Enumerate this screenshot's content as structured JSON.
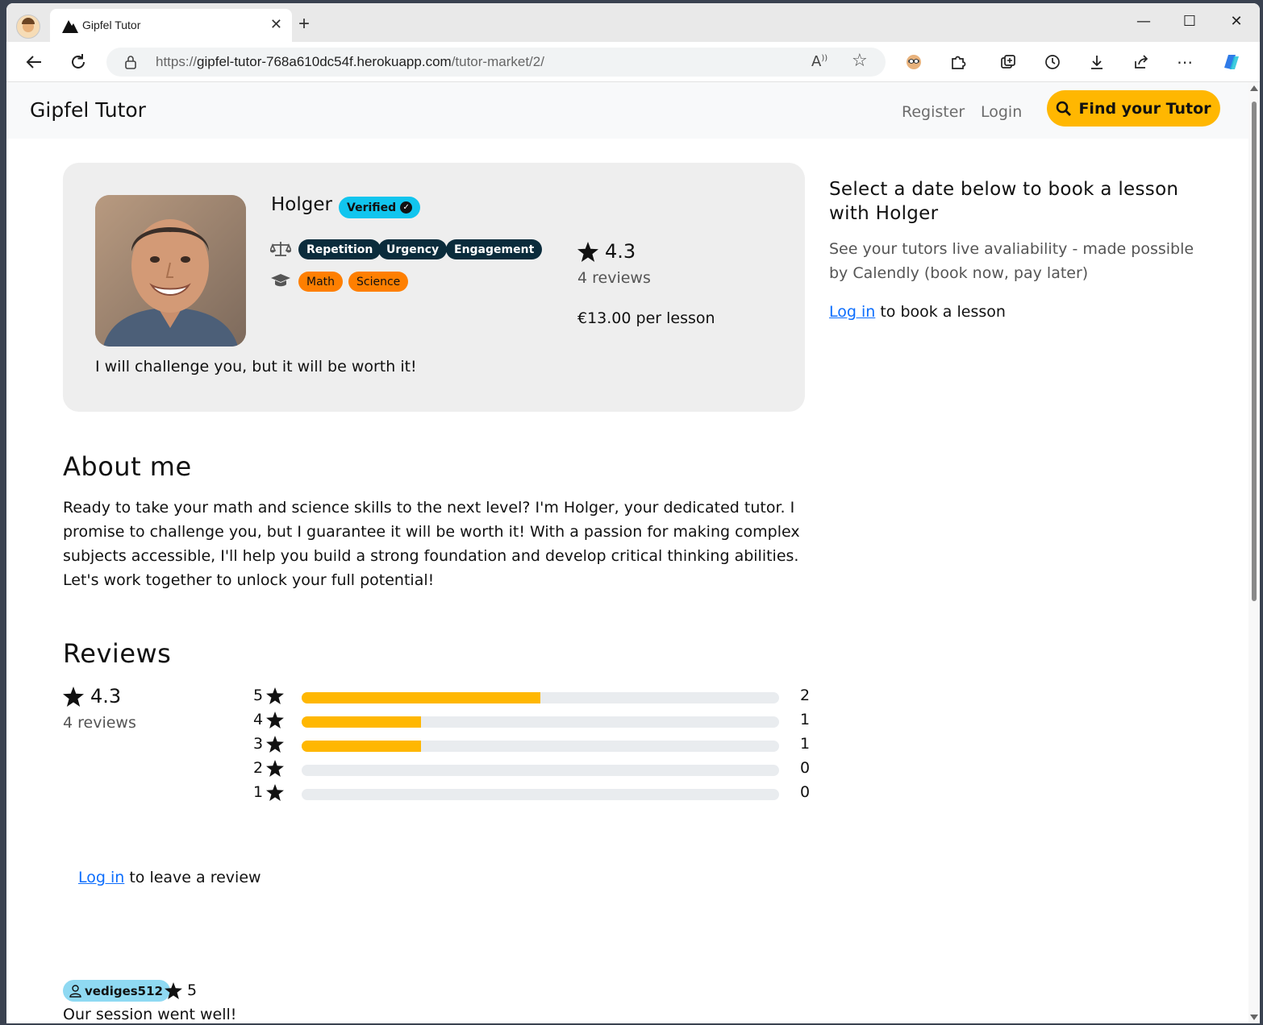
{
  "browser": {
    "tab_title": "Gipfel Tutor",
    "url_prefix": "https://",
    "url_host": "gipfel-tutor-768a610dc54f.herokuapp.com",
    "url_path": "/tutor-market/2/"
  },
  "nav": {
    "brand": "Gipfel Tutor",
    "register": "Register",
    "login": "Login",
    "find_button": "Find your Tutor"
  },
  "tutor": {
    "name": "Holger",
    "verified_label": "Verified",
    "teaching_styles": [
      "Repetition",
      "Urgency",
      "Engagement"
    ],
    "subjects": [
      "Math",
      "Science"
    ],
    "rating": "4.3",
    "reviews_count": "4 reviews",
    "price": "€13.00 per lesson",
    "tagline": "I will challenge you, but it will be worth it!"
  },
  "booking": {
    "title": "Select a date below to book a lesson with Holger",
    "subtitle": "See your tutors live avaliability - made possible by Calendly (book now, pay later)",
    "login_link": "Log in",
    "login_suffix": " to book a lesson"
  },
  "about": {
    "heading": "About me",
    "text": "Ready to take your math and science skills to the next level? I'm Holger, your dedicated tutor. I promise to challenge you, but I guarantee it will be worth it! With a passion for making complex subjects accessible, I'll help you build a strong foundation and develop critical thinking abilities. Let's work together to unlock your full potential!"
  },
  "reviews": {
    "heading": "Reviews",
    "rating": "4.3",
    "count": "4 reviews",
    "histogram": [
      {
        "stars": "5",
        "count": "2",
        "fraction": 0.5
      },
      {
        "stars": "4",
        "count": "1",
        "fraction": 0.25
      },
      {
        "stars": "3",
        "count": "1",
        "fraction": 0.25
      },
      {
        "stars": "2",
        "count": "0",
        "fraction": 0
      },
      {
        "stars": "1",
        "count": "0",
        "fraction": 0
      }
    ],
    "login_link": "Log in",
    "login_suffix": " to leave a review",
    "items": [
      {
        "user": "vediges512",
        "score": "5",
        "text": "Our session went well!"
      }
    ]
  },
  "colors": {
    "accent": "#ffb701",
    "verified": "#11c5ee",
    "style_pill": "#0b2c3c",
    "subject_pill": "#fe7f01",
    "link": "#0d6efd"
  }
}
